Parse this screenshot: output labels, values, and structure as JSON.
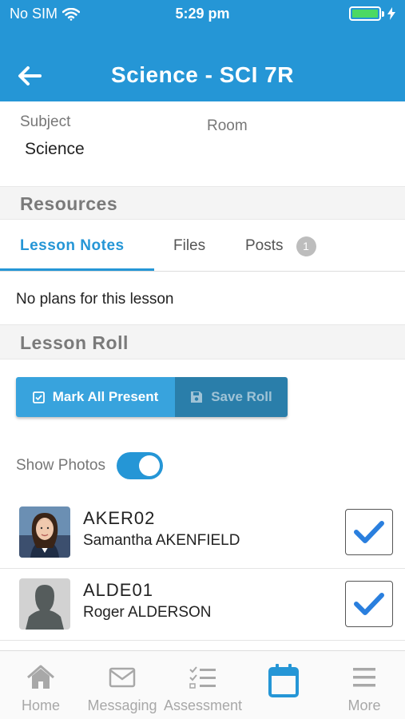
{
  "status_bar": {
    "carrier": "No SIM",
    "time": "5:29 pm"
  },
  "header": {
    "title": "Science - SCI 7R",
    "back_icon": "arrow-left-icon",
    "color": "#2596d6"
  },
  "info": {
    "subject_label": "Subject",
    "subject_value": "Science",
    "room_label": "Room"
  },
  "resources": {
    "heading": "Resources",
    "tabs": [
      {
        "label": "Lesson Notes",
        "active": true
      },
      {
        "label": "Files"
      },
      {
        "label": "Posts",
        "badge": "1"
      }
    ],
    "empty_text": "No plans for this lesson"
  },
  "lesson_roll": {
    "heading": "Lesson Roll",
    "mark_all_label": "Mark All Present",
    "save_label": "Save Roll",
    "show_photos_label": "Show Photos",
    "show_photos_on": true,
    "students": [
      {
        "id": "AKER02",
        "name": "Samantha AKENFIELD",
        "present": true,
        "photo": "student-photo"
      },
      {
        "id": "ALDE01",
        "name": "Roger ALDERSON",
        "present": true,
        "photo": "placeholder-silhouette"
      }
    ]
  },
  "tabbar": {
    "items": [
      {
        "label": "Home",
        "icon": "home-icon"
      },
      {
        "label": "Messaging",
        "icon": "envelope-icon"
      },
      {
        "label": "Assessment",
        "icon": "checklist-icon"
      },
      {
        "label": "",
        "icon": "calendar-icon",
        "active": true
      },
      {
        "label": "More",
        "icon": "menu-icon"
      }
    ]
  }
}
